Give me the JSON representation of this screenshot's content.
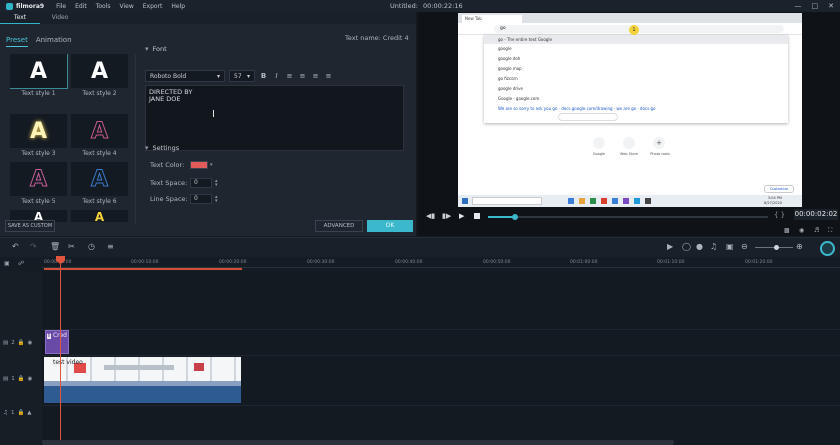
{
  "app": {
    "name": "filmora9",
    "menu": [
      "File",
      "Edit",
      "Tools",
      "View",
      "Export",
      "Help"
    ],
    "title": "Untitled:",
    "time": "00:00:22:16"
  },
  "left_tabs": [
    "Text",
    "Video"
  ],
  "sub_tabs": [
    "Preset",
    "Animation"
  ],
  "text_name": "Text name: Credit 4",
  "styles": [
    {
      "label": "Text style 1",
      "glyph": "A"
    },
    {
      "label": "Text style 2",
      "glyph": "A"
    },
    {
      "label": "Text style 3",
      "glyph": "A"
    },
    {
      "label": "Text style 4",
      "glyph": "A"
    },
    {
      "label": "Text style 5",
      "glyph": "A"
    },
    {
      "label": "Text style 6",
      "glyph": "A"
    },
    {
      "label": "",
      "glyph": "A"
    },
    {
      "label": "",
      "glyph": "A"
    }
  ],
  "font_section": {
    "title": "Font",
    "font": "Roboto Bold",
    "size": "57",
    "format": [
      "B",
      "I"
    ],
    "text_line1": "DIRECTED BY",
    "text_line2": "JANE DOE"
  },
  "settings": {
    "title": "Settings",
    "text_color_label": "Text Color:",
    "text_color": "#e25b5b",
    "text_space_label": "Text Space:",
    "text_space": "0",
    "line_space_label": "Line Space:",
    "line_space": "0"
  },
  "buttons": {
    "save_custom": "SAVE AS CUSTOM",
    "advanced": "ADVANCED",
    "ok": "OK"
  },
  "preview": {
    "timecode": "00:00:02:02",
    "browser_tab": "New Tab",
    "search_query": "go",
    "suggestions": [
      "go - The entire text Google",
      "google",
      "google doh",
      "google map",
      "go fizcorn",
      "google drive",
      "Google · google.com",
      "We are so sorry to ask you go · docs.google.com/drawing · we are go · docs.go"
    ],
    "shortcuts": [
      "Google",
      "Web Store",
      "Photo tools"
    ],
    "customize_label": "Customize",
    "task_time": "3:04 PM",
    "task_date": "8/27/2020",
    "cursor_badge": "1"
  },
  "ruler": [
    "00:00:00:00",
    "00:00:10:00",
    "00:00:20:00",
    "00:00:30:00",
    "00:00:40:00",
    "00:00:50:00",
    "00:01:00:00",
    "00:01:10:00",
    "00:01:20:00"
  ],
  "tracks": {
    "title_track": "2",
    "video_track": "1",
    "audio_track": "1",
    "title_clip": "Cred",
    "video_clip": "test video"
  },
  "colors": {
    "accent": "#3cb8cd",
    "playhead": "#e2563d",
    "title_clip": "#6a4aa7",
    "audio_clip": "#2f5b93"
  }
}
